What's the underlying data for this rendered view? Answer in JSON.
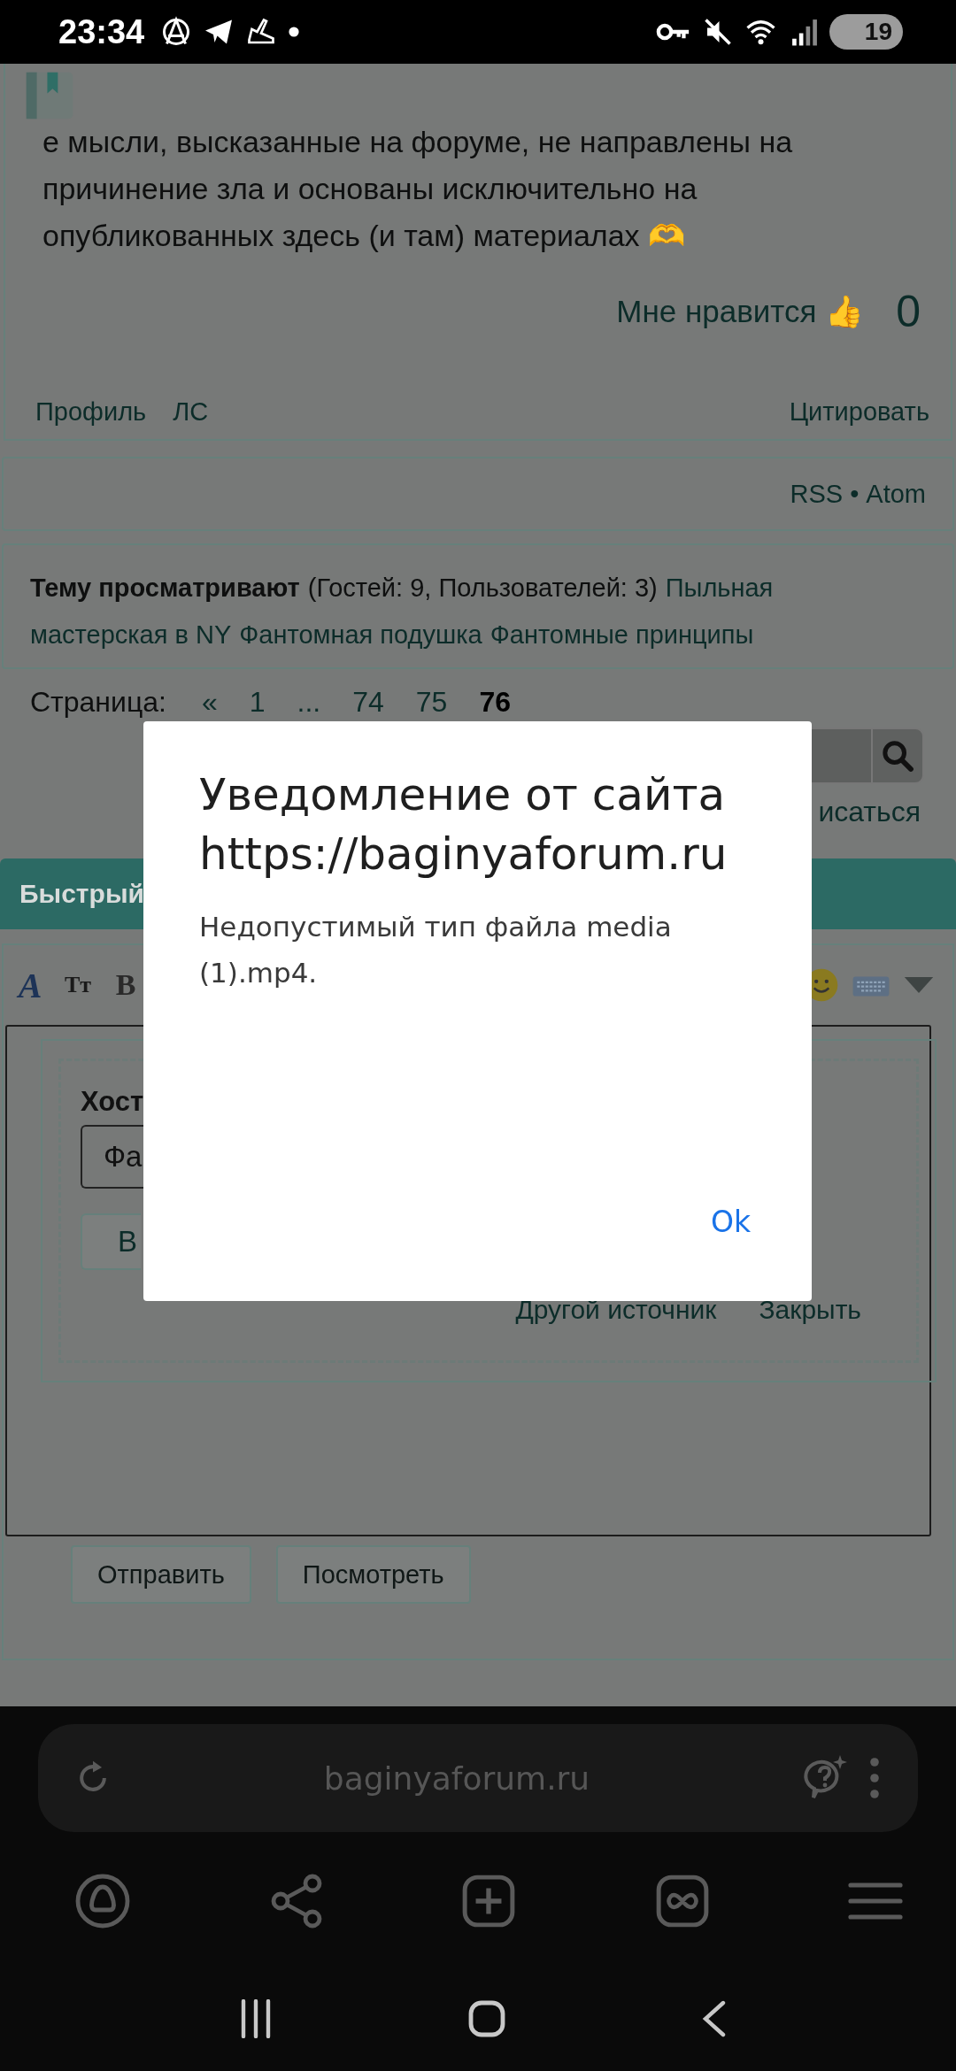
{
  "status_bar": {
    "time": "23:34",
    "battery": "19"
  },
  "post": {
    "text": "е мысли, высказанные на форуме, не направлены на причинение зла и основаны исключительно на опубликованных здесь (и там) материалах 🫶",
    "like_label": "Мне нравится 👍",
    "like_count": "0",
    "links": [
      "Профиль",
      "ЛС"
    ],
    "quote": "Цитировать"
  },
  "feeds": {
    "rss": "RSS",
    "separator": "•",
    "atom": "Atom"
  },
  "viewers": {
    "label": "Тему просматривают",
    "counts": "(Гостей: 9, Пользователей: 3)",
    "users": [
      "Пыльная",
      "мастерская в NY",
      "Фантомная подушка",
      "Фантомные принципы"
    ]
  },
  "pagination": {
    "label": "Страница:",
    "items": [
      {
        "text": "«",
        "selected": false
      },
      {
        "text": "1",
        "selected": false
      },
      {
        "text": "...",
        "selected": false
      },
      {
        "text": "74",
        "selected": false
      },
      {
        "text": "75",
        "selected": false
      },
      {
        "text": "76",
        "selected": true
      }
    ]
  },
  "subscribe_partial": "исаться",
  "quick_reply": {
    "title": "Быстрый",
    "toolbar": [
      "A",
      "Тт",
      "B"
    ],
    "host_label": "Хост",
    "host_value": "Фа",
    "upload_button": "В",
    "other_source": "Другой источник",
    "close": "Закрыть",
    "buttons": [
      "Отправить",
      "Посмотреть"
    ]
  },
  "dialog": {
    "title": "Уведомление от сайта https://baginyaforum.ru",
    "message": "Недопустимый тип файла media (1).mp4.",
    "button": "Ok"
  },
  "browser": {
    "url": "baginyaforum.ru"
  }
}
